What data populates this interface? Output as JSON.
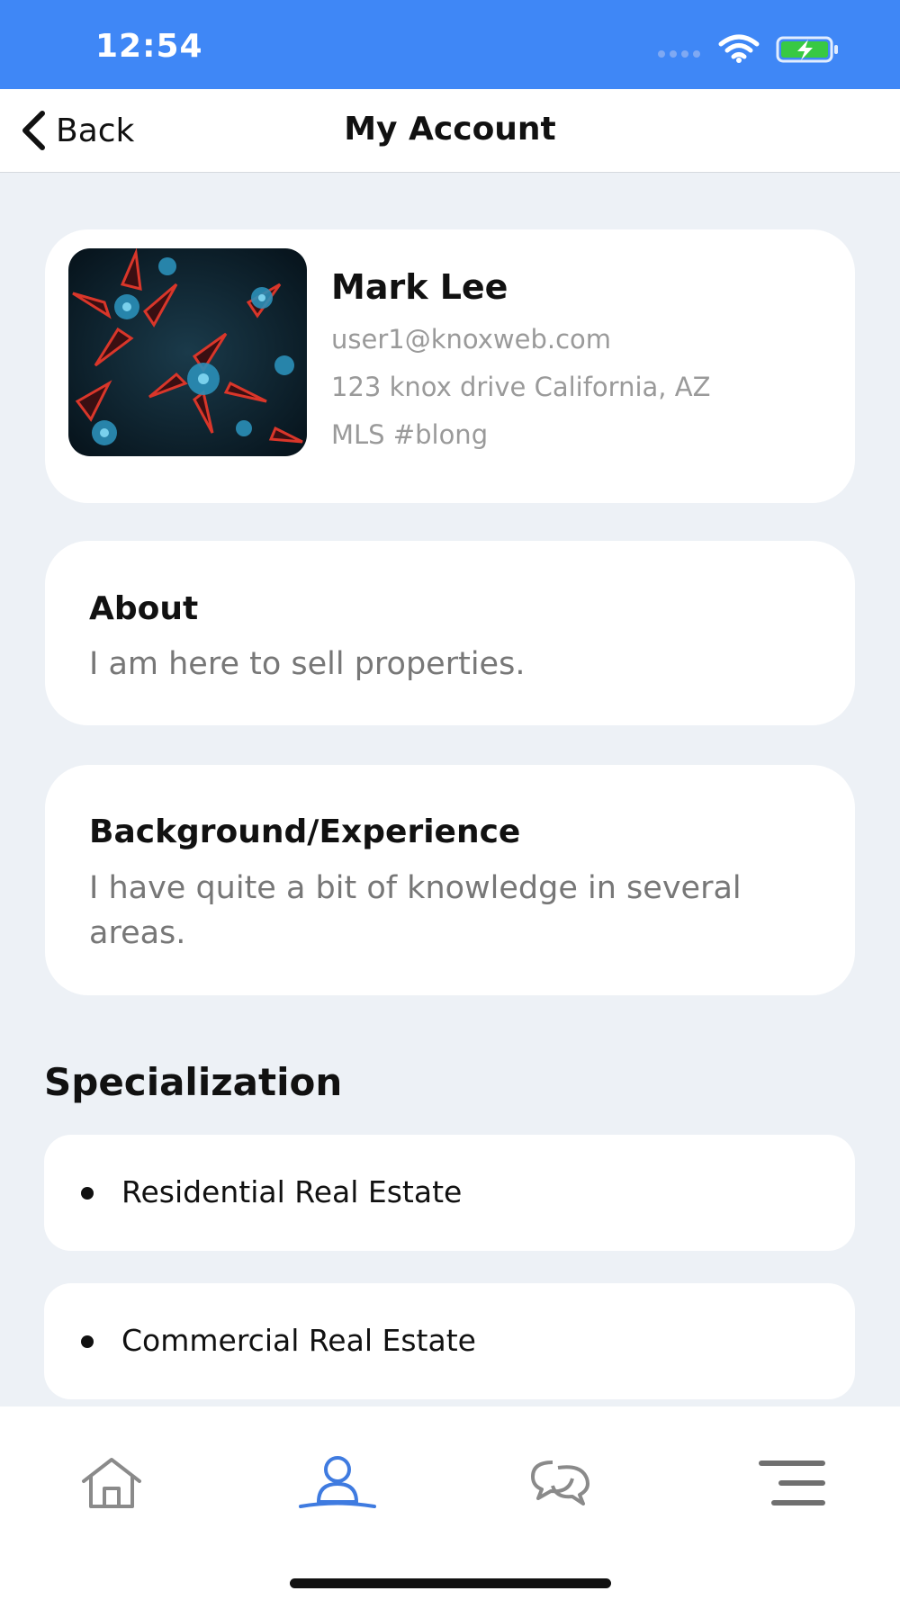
{
  "status_bar": {
    "time": "12:54"
  },
  "nav": {
    "back_label": "Back",
    "title": "My Account"
  },
  "profile": {
    "name": "Mark Lee",
    "email": "user1@knoxweb.com",
    "address": "123 knox drive California, AZ",
    "mls": "MLS #blong"
  },
  "about": {
    "title": "About",
    "text": "I am here to sell properties."
  },
  "background": {
    "title": "Background/Experience",
    "text": "I have quite a bit of knowledge in several areas."
  },
  "specialization": {
    "heading": "Specialization",
    "items": [
      {
        "label": "Residential Real Estate"
      },
      {
        "label": "Commercial Real Estate"
      }
    ]
  },
  "tab_bar": {
    "tabs": [
      {
        "icon": "home-icon",
        "active": false
      },
      {
        "icon": "user-icon",
        "active": true
      },
      {
        "icon": "chat-icon",
        "active": false
      },
      {
        "icon": "menu-icon",
        "active": false
      }
    ]
  },
  "colors": {
    "status_bar": "#3f87f6",
    "active_tab": "#3f7be0",
    "battery": "#38c943"
  }
}
